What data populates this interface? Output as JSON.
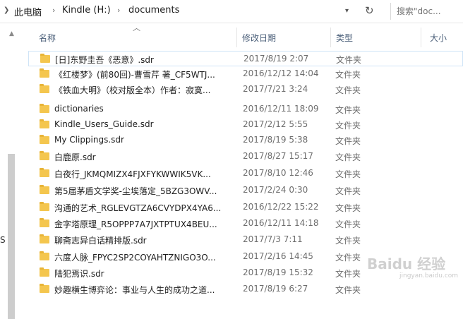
{
  "address": {
    "breadcrumb": [
      "此电脑",
      "Kindle (H:)",
      "documents"
    ],
    "separator": "›"
  },
  "search": {
    "placeholder": "搜索\"doc..."
  },
  "nav": {
    "label": "S"
  },
  "columns": {
    "name": "名称",
    "date": "修改日期",
    "type": "类型",
    "size": "大小"
  },
  "files": [
    {
      "name": "[日]东野圭吾《恶意》.sdr",
      "date": "2017/8/19 2:07",
      "type": "文件夹"
    },
    {
      "name": "《红楼梦》(前80回)-曹雪芹 著_CF5WTJ...",
      "date": "2016/12/12 14:04",
      "type": "文件夹"
    },
    {
      "name": "《铁血大明》（校对版全本）作者：寂寞...",
      "date": "2017/7/21 3:24",
      "type": "文件夹"
    },
    {
      "name": "dictionaries",
      "date": "2016/12/11 18:09",
      "type": "文件夹"
    },
    {
      "name": "Kindle_Users_Guide.sdr",
      "date": "2017/2/12 5:55",
      "type": "文件夹"
    },
    {
      "name": "My Clippings.sdr",
      "date": "2017/8/19 5:38",
      "type": "文件夹"
    },
    {
      "name": "白鹿原.sdr",
      "date": "2017/8/27 15:17",
      "type": "文件夹"
    },
    {
      "name": "白夜行_JKMQMIZX4FJXFYKWWIK5VK...",
      "date": "2017/8/10 12:46",
      "type": "文件夹"
    },
    {
      "name": "第5届茅盾文学奖-尘埃落定_5BZG3OWV...",
      "date": "2017/2/24 0:30",
      "type": "文件夹"
    },
    {
      "name": "沟通的艺术_RGLEVGTZA6CVYDPX4YA6...",
      "date": "2016/12/22 15:22",
      "type": "文件夹"
    },
    {
      "name": "金字塔原理_R5OPPP7A7JXTPTUX4BEU...",
      "date": "2016/12/11 14:18",
      "type": "文件夹"
    },
    {
      "name": "聊斋志异白话精排版.sdr",
      "date": "2017/7/3 7:11",
      "type": "文件夹"
    },
    {
      "name": "六度人脉_FPYC2SP2COYAHTZNIGO3O...",
      "date": "2017/2/16 14:45",
      "type": "文件夹"
    },
    {
      "name": "陆犯焉识.sdr",
      "date": "2017/8/19 15:32",
      "type": "文件夹"
    },
    {
      "name": "妙趣横生博弈论：事业与人生的成功之道...",
      "date": "2017/8/19 6:27",
      "type": "文件夹"
    }
  ],
  "colors": {
    "folder": "#f4c64e",
    "header_text": "#4c607a",
    "selection_border": "#cfe4f7"
  },
  "watermark": {
    "text": "Baidu 经验",
    "sub": "jingyan.baidu.com"
  }
}
